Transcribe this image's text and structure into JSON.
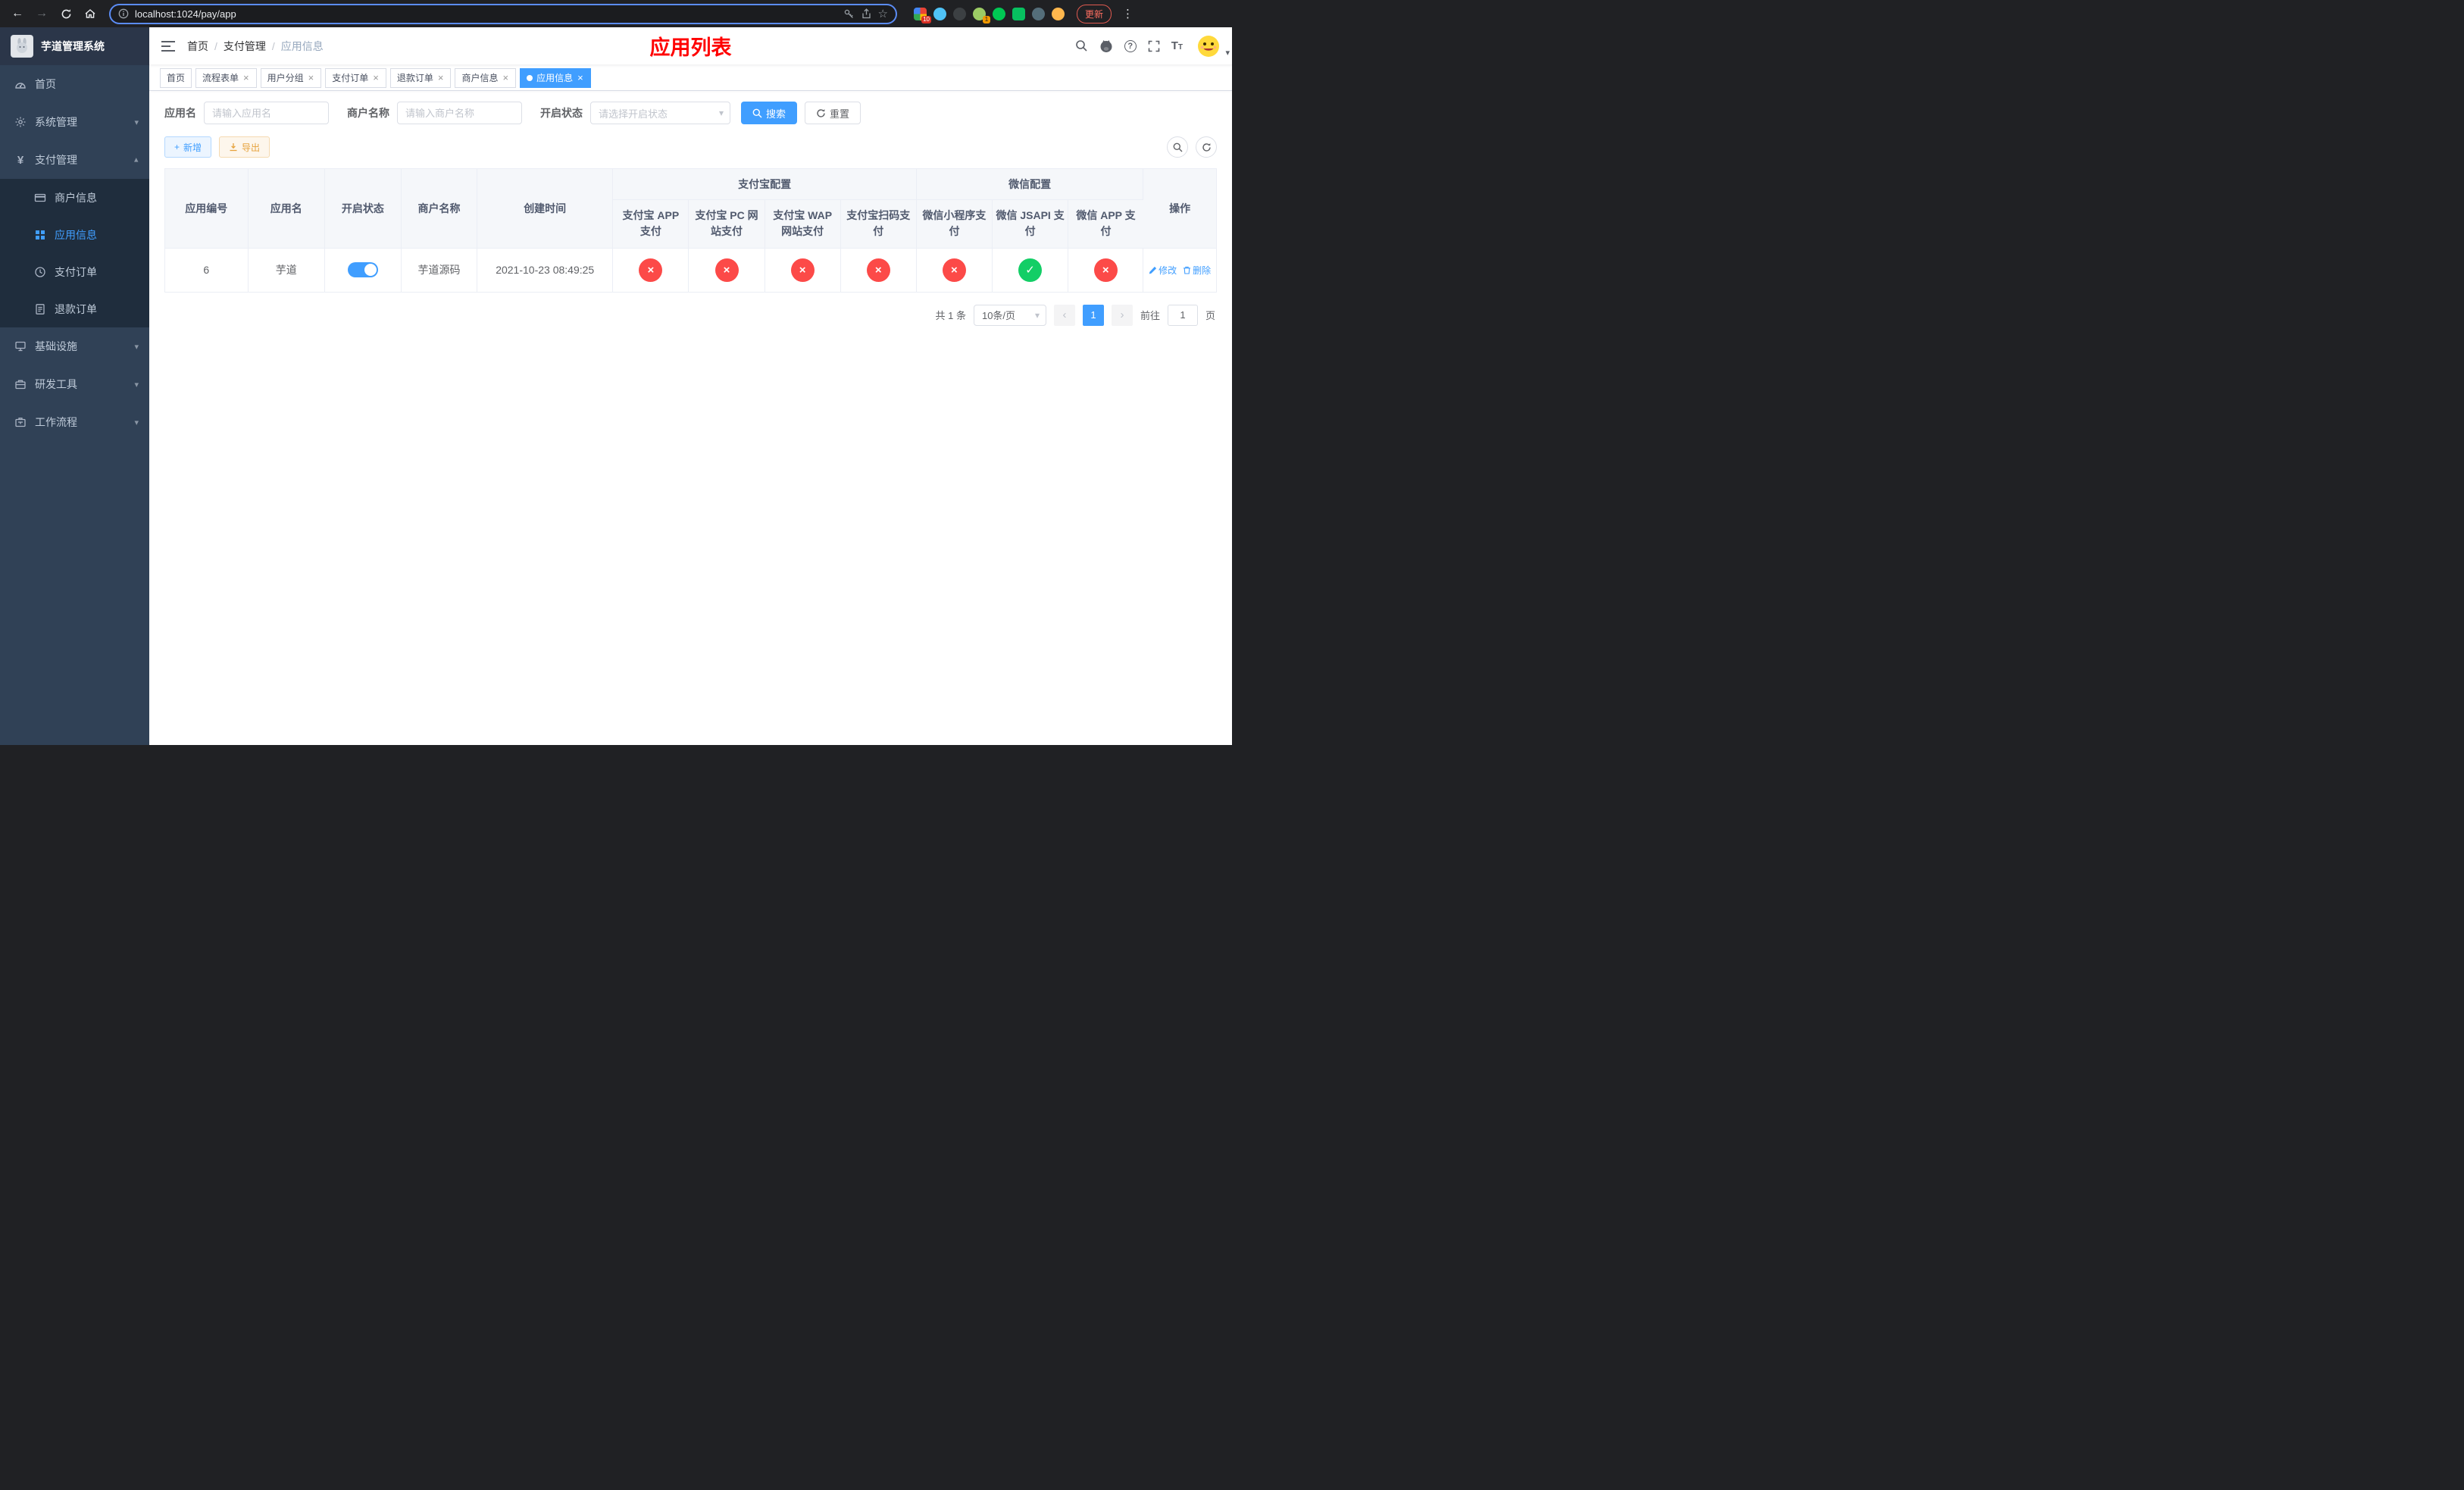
{
  "icons": {
    "back": "←",
    "forward": "→",
    "more": "⋮",
    "star": "☆",
    "close": "×",
    "check": "✓",
    "cross": "×",
    "caret_down": "▾",
    "slash": "/",
    "question": "?",
    "plus": "+",
    "chevron_left": "‹",
    "chevron_right": "›",
    "font_large": "T",
    "font_small": "T"
  },
  "browser": {
    "url": "localhost:1024/pay/app",
    "update_button": "更新",
    "ext_badge_apps": "10",
    "ext_badge_avatar": "1"
  },
  "sidebar": {
    "logo_title": "芋道管理系统",
    "home": "首页",
    "system": "系统管理",
    "payment": "支付管理",
    "merchant_info": "商户信息",
    "app_info": "应用信息",
    "pay_order": "支付订单",
    "refund_order": "退款订单",
    "infrastructure": "基础设施",
    "dev_tools": "研发工具",
    "workflow": "工作流程"
  },
  "navbar": {
    "breadcrumb": {
      "home": "首页",
      "payment": "支付管理",
      "current": "应用信息"
    },
    "page_title": "应用列表"
  },
  "tabs": {
    "home": "首页",
    "flow_form": "流程表单",
    "user_group": "用户分组",
    "pay_order": "支付订单",
    "refund_order": "退款订单",
    "merchant_info": "商户信息",
    "app_info": "应用信息"
  },
  "filters": {
    "app_name_label": "应用名",
    "app_name_placeholder": "请输入应用名",
    "merchant_label": "商户名称",
    "merchant_placeholder": "请输入商户名称",
    "status_label": "开启状态",
    "status_placeholder": "请选择开启状态",
    "search_button": "搜索",
    "reset_button": "重置"
  },
  "toolbar": {
    "add_label": "新增",
    "export_label": "导出"
  },
  "table": {
    "group_alipay": "支付宝配置",
    "group_wechat": "微信配置",
    "col_app_id": "应用编号",
    "col_app_name": "应用名",
    "col_status": "开启状态",
    "col_merchant": "商户名称",
    "col_created": "创建时间",
    "col_alipay_app": "支付宝 APP 支付",
    "col_alipay_pc": "支付宝 PC 网站支付",
    "col_alipay_wap": "支付宝 WAP 网站支付",
    "col_alipay_qr": "支付宝扫码支付",
    "col_wx_lite": "微信小程序支付",
    "col_wx_jsapi": "微信 JSAPI 支付",
    "col_wx_app": "微信 APP 支付",
    "col_actions": "操作",
    "row": {
      "app_id": "6",
      "app_name": "芋道",
      "status_on": true,
      "merchant": "芋道源码",
      "created": "2021-10-23 08:49:25",
      "config": {
        "alipay_app": false,
        "alipay_pc": false,
        "alipay_wap": false,
        "alipay_qr": false,
        "wx_lite": false,
        "wx_jsapi": true,
        "wx_app": false
      },
      "edit_label": "修改",
      "delete_label": "删除"
    }
  },
  "pagination": {
    "total": "共 1 条",
    "page_size": "10条/页",
    "page": "1",
    "goto_prefix": "前往",
    "goto_value": "1",
    "goto_suffix": "页"
  },
  "colors": {
    "accent": "#409eff",
    "danger": "#fc4a48",
    "success": "#13ce66",
    "title_red": "#ff0000"
  }
}
